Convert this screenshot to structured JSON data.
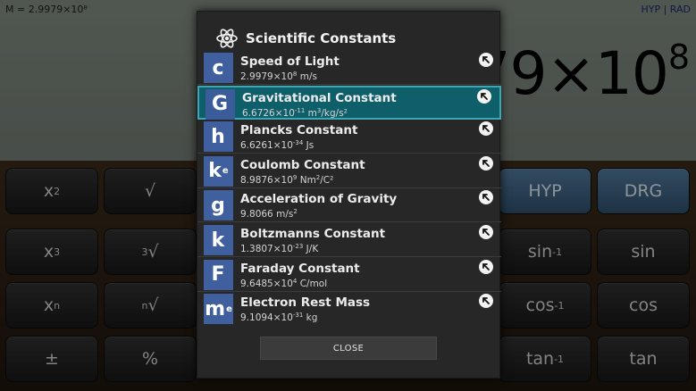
{
  "display": {
    "memory": "M = 2.9979×10⁸",
    "mode": "HYP | RAD",
    "value_main": "79×10",
    "value_exp": "8"
  },
  "keys": [
    {
      "id": "x2",
      "label": "x",
      "sup": "2",
      "style": "dark"
    },
    {
      "id": "sqrt",
      "label": "√",
      "sup": "",
      "style": "dark"
    },
    {
      "id": "hyp",
      "label": "HYP",
      "sup": "",
      "style": "blue"
    },
    {
      "id": "drg",
      "label": "DRG",
      "sup": "",
      "style": "blue"
    },
    {
      "id": "x3",
      "label": "x",
      "sup": "3",
      "style": "dark"
    },
    {
      "id": "cbrt",
      "label": "√",
      "sup": "3",
      "style": "dark"
    },
    {
      "id": "asin",
      "label": "sin",
      "sup": "-1",
      "style": "dark"
    },
    {
      "id": "sin",
      "label": "sin",
      "sup": "",
      "style": "dark"
    },
    {
      "id": "xn",
      "label": "x",
      "sup": "n",
      "style": "dark"
    },
    {
      "id": "nrt",
      "label": "√",
      "sup": "n",
      "style": "dark"
    },
    {
      "id": "acos",
      "label": "cos",
      "sup": "-1",
      "style": "dark"
    },
    {
      "id": "cos",
      "label": "cos",
      "sup": "",
      "style": "dark"
    },
    {
      "id": "plusminus",
      "label": "±",
      "sup": "",
      "style": "dark"
    },
    {
      "id": "percent",
      "label": "%",
      "sup": "",
      "style": "dark"
    },
    {
      "id": "atan",
      "label": "tan",
      "sup": "-1",
      "style": "dark"
    },
    {
      "id": "tan",
      "label": "tan",
      "sup": "",
      "style": "dark"
    }
  ],
  "dialog": {
    "title": "Scientific Constants",
    "close_label": "CLOSE",
    "constants": [
      {
        "symbol": "c",
        "sub": "",
        "name": "Speed of Light",
        "mant": "2.9979×10",
        "exp": "8",
        "unit": " m/s",
        "unit_sup": "",
        "unit_tail": "",
        "selected": false
      },
      {
        "symbol": "G",
        "sub": "",
        "name": "Gravitational Constant",
        "mant": "6.6726×10",
        "exp": "-11",
        "unit": " m",
        "unit_sup": "3",
        "unit_tail": "/kg/s²",
        "selected": true
      },
      {
        "symbol": "h",
        "sub": "",
        "name": "Plancks Constant",
        "mant": "6.6261×10",
        "exp": "-34",
        "unit": " Js",
        "unit_sup": "",
        "unit_tail": "",
        "selected": false
      },
      {
        "symbol": "k",
        "sub": "e",
        "name": "Coulomb Constant",
        "mant": "8.9876×10",
        "exp": "9",
        "unit": " Nm",
        "unit_sup": "2",
        "unit_tail": "/C²",
        "selected": false
      },
      {
        "symbol": "g",
        "sub": "",
        "name": "Acceleration of Gravity",
        "mant": "9.8066",
        "exp": "",
        "unit": " m/s",
        "unit_sup": "2",
        "unit_tail": "",
        "selected": false
      },
      {
        "symbol": "k",
        "sub": "",
        "name": "Boltzmanns Constant",
        "mant": "1.3807×10",
        "exp": "-23",
        "unit": " J/K",
        "unit_sup": "",
        "unit_tail": "",
        "selected": false
      },
      {
        "symbol": "F",
        "sub": "",
        "name": "Faraday Constant",
        "mant": "9.6485×10",
        "exp": "4",
        "unit": " C/mol",
        "unit_sup": "",
        "unit_tail": "",
        "selected": false
      },
      {
        "symbol": "m",
        "sub": "e",
        "name": "Electron Rest Mass",
        "mant": "9.1094×10",
        "exp": "-31",
        "unit": " kg",
        "unit_sup": "",
        "unit_tail": "",
        "selected": false
      }
    ]
  },
  "colors": {
    "tile": "#3f5f9e",
    "selected_bg": "#0f5f6b",
    "selected_border": "#3fa7b4",
    "blue_key": "#4f7596"
  },
  "icons": {
    "header": "atom-icon",
    "row_action": "insert-arrow-icon"
  }
}
